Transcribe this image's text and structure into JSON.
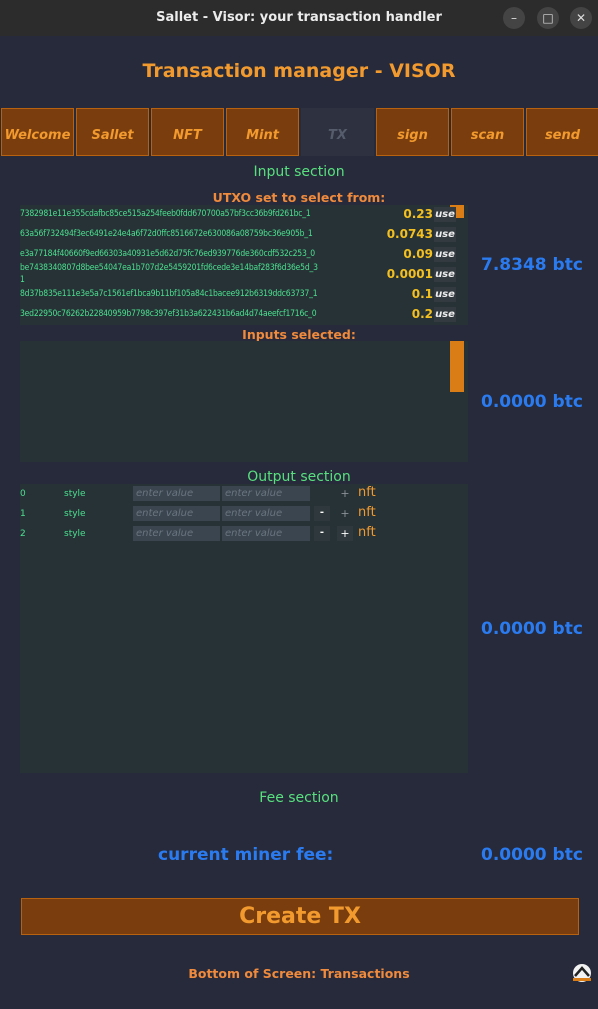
{
  "window": {
    "title": "Sallet - Visor: your transaction handler",
    "minimize": "–",
    "maximize": "□",
    "close": "✕"
  },
  "heading": "Transaction manager - VISOR",
  "tabs": [
    {
      "label": "Welcome",
      "active": false
    },
    {
      "label": "Sallet",
      "active": false
    },
    {
      "label": "NFT",
      "active": false
    },
    {
      "label": "Mint",
      "active": false
    },
    {
      "label": "TX",
      "active": true
    },
    {
      "label": "sign",
      "active": false
    },
    {
      "label": "scan",
      "active": false
    },
    {
      "label": "send",
      "active": false
    }
  ],
  "input_section": {
    "title": "Input section",
    "utxo_label": "UTXO set to select from:",
    "utxos": [
      {
        "id": "7382981e11e355cdafbc85ce515a254feeb0fdd670700a57bf3cc36b9fd261bc_1",
        "amount": "0.23",
        "use": "use"
      },
      {
        "id": "63a56f732494f3ec6491e24e4a6f72d0ffc8516672e630086a08759bc36e905b_1",
        "amount": "0.0743",
        "use": "use"
      },
      {
        "id": "e3a77184f40660f9ed66303a40931e5d62d75fc76ed939776de360cdf532c253_0",
        "amount": "0.09",
        "use": "use"
      },
      {
        "id": "be7438340807d8bee54047ea1b707d2e5459201fd6cede3e14baf283f6d36e5d_3",
        "id2": "1",
        "amount": "0.0001",
        "use": "use"
      },
      {
        "id": "8d37b835e111e3e5a7c1561ef1bca9b11bf105a84c1bacee912b6319ddc63737_1",
        "amount": "0.1",
        "use": "use"
      },
      {
        "id": "3ed22950c76262b22840959b7798c397ef31b3a622431b6ad4d74aeefcf1716c_0",
        "amount": "0.2",
        "use": "use"
      }
    ],
    "utxo_total": "7.8348 btc",
    "selected_label": "Inputs selected:",
    "selected_total": "0.0000 btc"
  },
  "output_section": {
    "title": "Output section",
    "rows": [
      {
        "index": "0",
        "style": "style",
        "value_placeholder": "enter value",
        "value2_placeholder": "enter value",
        "minus": "",
        "plus": "+",
        "plus_active": false,
        "nft": "nft"
      },
      {
        "index": "1",
        "style": "style",
        "value_placeholder": "enter value",
        "value2_placeholder": "enter value",
        "minus": "-",
        "plus": "+",
        "plus_active": false,
        "nft": "nft"
      },
      {
        "index": "2",
        "style": "style",
        "value_placeholder": "enter value",
        "value2_placeholder": "enter value",
        "minus": "-",
        "plus": "+",
        "plus_active": true,
        "nft": "nft"
      }
    ],
    "total": "0.0000 btc"
  },
  "fee_section": {
    "title": "Fee section",
    "label": "current miner fee:",
    "value": "0.0000 btc"
  },
  "create_button": "Create TX",
  "footer": "Bottom of Screen: Transactions"
}
